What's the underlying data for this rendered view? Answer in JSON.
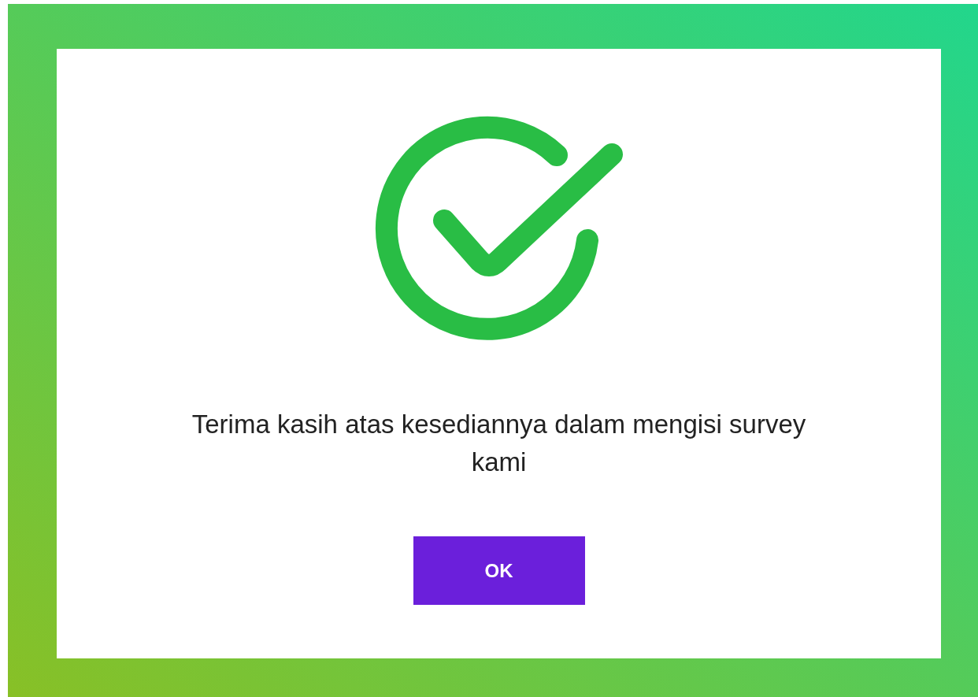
{
  "dialog": {
    "message": "Terima kasih atas kesediannya dalam mengisi survey kami",
    "button": "OK"
  }
}
